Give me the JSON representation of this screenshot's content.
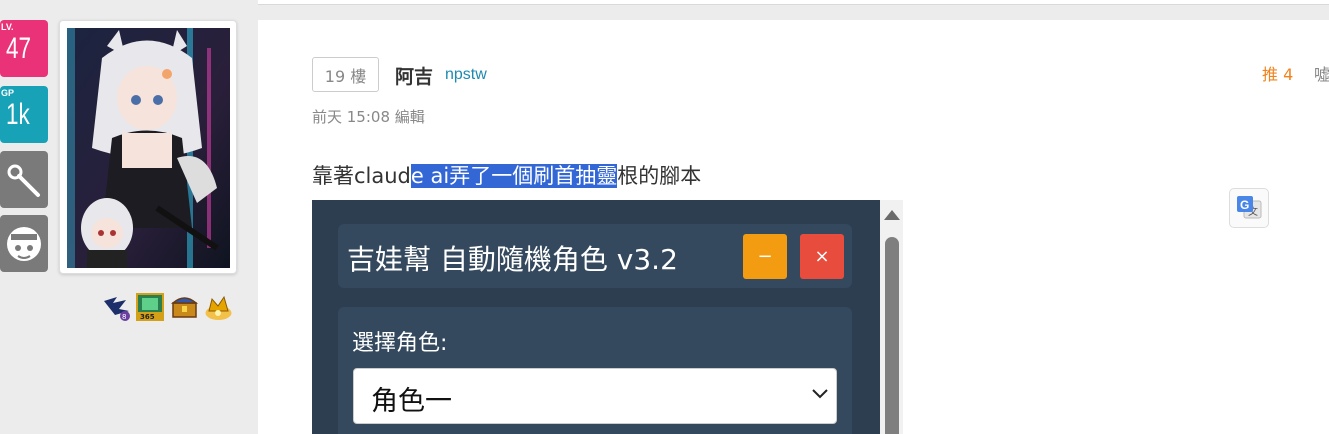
{
  "sidebar": {
    "level": {
      "label": "LV.",
      "value": "47"
    },
    "gp": {
      "label": "GP",
      "value": "1k"
    },
    "icons": [
      "wand-icon",
      "mascot-face-icon"
    ],
    "medals": [
      "dragon-medal-icon",
      "365-medal-icon",
      "treasure-chest-medal-icon",
      "crown-medal-icon"
    ]
  },
  "post": {
    "floor": "19 樓",
    "author_name": "阿吉",
    "author_id": "npstw",
    "edit_time": "前天 15:08 編輯",
    "push": "推 4",
    "boo": "噓",
    "content": {
      "before": "靠著claud",
      "selected": "e ai弄了一個刷首抽靈",
      "after": "根的腳本"
    }
  },
  "screenshot": {
    "app_title": "吉娃幫 自動隨機角色 v3.2",
    "minimize_label": "−",
    "close_label": "×",
    "role_label": "選擇角色:",
    "role_selected": "角色一"
  },
  "colors": {
    "level_badge": "#ea3278",
    "gp_badge": "#17a2b8",
    "icon_badge": "#7a7a7a",
    "push": "#f0831e",
    "author_id": "#1e8ab0",
    "selection": "#3367d6",
    "app_bg": "#2c3e50",
    "app_panel": "#34495e",
    "minimize": "#f39c12",
    "close": "#e74c3c"
  }
}
